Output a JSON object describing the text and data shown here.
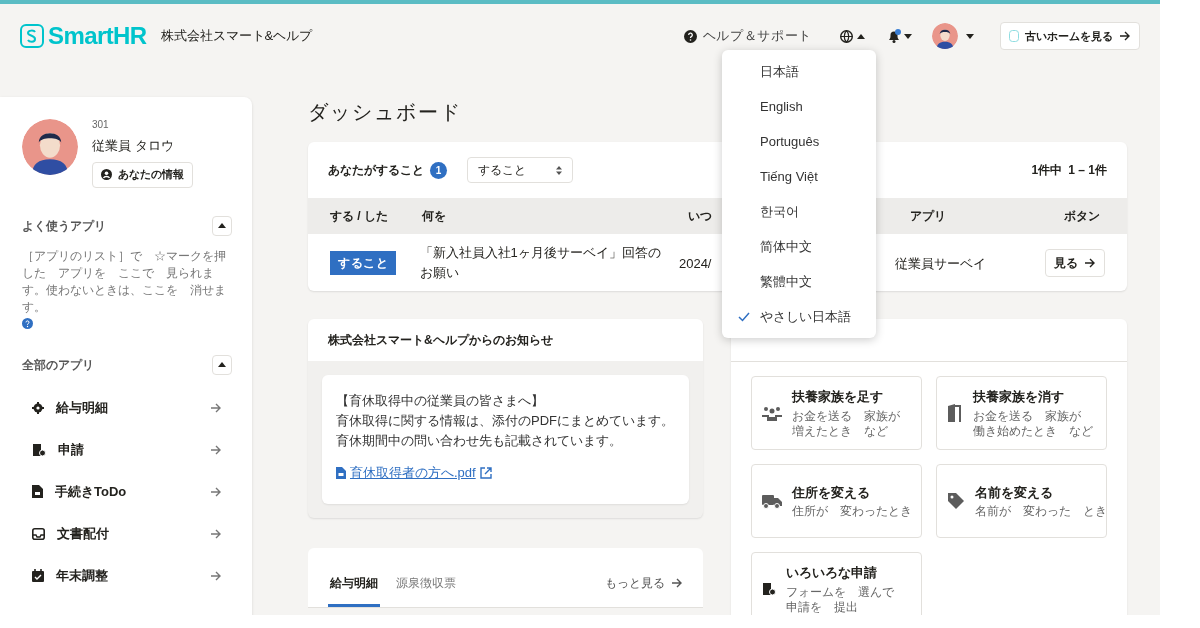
{
  "header": {
    "logo": "SmartHR",
    "company": "株式会社スマート&ヘルプ",
    "help": "ヘルプ＆サポート",
    "notifications": {
      "unread": true
    },
    "old_home": "古いホームを見る"
  },
  "language_menu": {
    "expanded": true,
    "items": [
      {
        "label": "日本語",
        "selected": false
      },
      {
        "label": "English",
        "selected": false
      },
      {
        "label": "Português",
        "selected": false
      },
      {
        "label": "Tiếng Việt",
        "selected": false
      },
      {
        "label": "한국어",
        "selected": false
      },
      {
        "label": "简体中文",
        "selected": false
      },
      {
        "label": "繁體中文",
        "selected": false
      },
      {
        "label": "やさしい日本語",
        "selected": true
      }
    ]
  },
  "sidebar": {
    "profile": {
      "number": "301",
      "name": "従業員 タロウ",
      "button": "あなたの情報"
    },
    "favorites": {
      "title": "よく使うアプリ",
      "expanded": true,
      "description": "［アプリのリスト］で　☆マークを押した　アプリを　ここで　見られます。使わないときは、ここを　消せます。"
    },
    "all_apps": {
      "title": "全部のアプリ",
      "expanded": true,
      "items": [
        {
          "label": "給与明細",
          "kind": "gear"
        },
        {
          "label": "申請",
          "kind": "form"
        },
        {
          "label": "手続きToDo",
          "kind": "file"
        },
        {
          "label": "文書配付",
          "kind": "inbox"
        },
        {
          "label": "年末調整",
          "kind": "calendar"
        }
      ]
    }
  },
  "dashboard": {
    "title": "ダッシュボード",
    "todo": {
      "title": "あなたがすること",
      "badge": "1",
      "filter": "すること",
      "count_total": "1件中",
      "count_range": "1 – 1件",
      "columns": [
        "する / した",
        "何を",
        "いつ",
        "アプリ",
        "ボタン"
      ],
      "rows": [
        {
          "status": "すること",
          "what": "「新入社員入社1ヶ月後サーベイ」回答のお願い",
          "when": "2024/",
          "app": "従業員サーベイ",
          "button": "見る"
        }
      ]
    },
    "notice": {
      "title": "株式会社スマート&ヘルプからのお知らせ",
      "lines": [
        "【育休取得中の従業員の皆さまへ】",
        "育休取得に関する情報は、添付のPDFにまとめています。",
        "育休期間中の問い合わせ先も記載されています。"
      ],
      "link": "育休取得者の方へ.pdf"
    },
    "payslip": {
      "tabs": [
        {
          "label": "給与明細",
          "selected": true
        },
        {
          "label": "源泉徴収票",
          "selected": false
        }
      ],
      "more": "もっと見る"
    },
    "requests": [
      {
        "title": "扶養家族を足す",
        "desc": [
          "お金を送る　家族が",
          "増えたとき　など"
        ],
        "kind": "people"
      },
      {
        "title": "扶養家族を消す",
        "desc": [
          "お金を送る　家族が",
          "働き始めたとき　など"
        ],
        "kind": "door"
      },
      {
        "title": "住所を変える",
        "desc": [
          "住所が　変わったとき"
        ],
        "kind": "truck"
      },
      {
        "title": "名前を変える",
        "desc": [
          "名前が　変わった　とき"
        ],
        "kind": "tag"
      },
      {
        "title": "いろいろな申請",
        "desc": [
          "フォームを　選んで",
          "申請を　提出"
        ],
        "kind": "form"
      }
    ]
  }
}
